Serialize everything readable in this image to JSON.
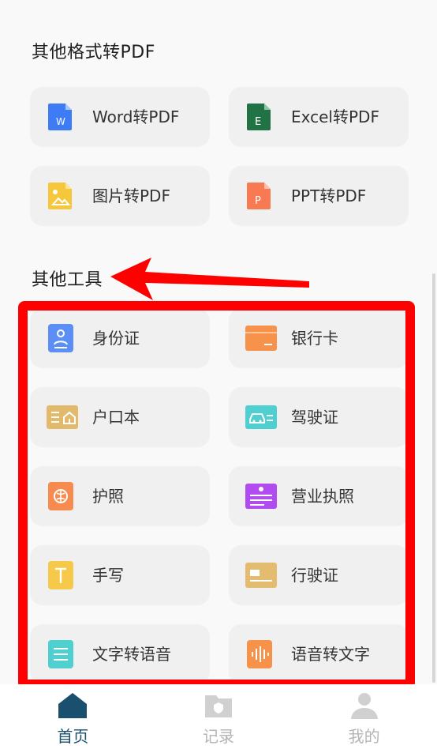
{
  "sections": {
    "convert_title": "其他格式转PDF",
    "tools_title": "其他工具"
  },
  "convert_cards": [
    {
      "label": "Word转PDF",
      "icon": "word-doc-icon",
      "color": "#3d7cf4"
    },
    {
      "label": "Excel转PDF",
      "icon": "excel-doc-icon",
      "color": "#217346"
    },
    {
      "label": "图片转PDF",
      "icon": "image-doc-icon",
      "color": "#f7c73b"
    },
    {
      "label": "PPT转PDF",
      "icon": "ppt-doc-icon",
      "color": "#f77a52"
    }
  ],
  "tool_cards": [
    {
      "label": "身份证",
      "icon": "id-card-icon",
      "color": "#5b8ff5"
    },
    {
      "label": "银行卡",
      "icon": "bank-card-icon",
      "color": "#f7924a"
    },
    {
      "label": "户口本",
      "icon": "household-register-icon",
      "color": "#e3b96b"
    },
    {
      "label": "驾驶证",
      "icon": "driver-license-icon",
      "color": "#4fcfd0"
    },
    {
      "label": "护照",
      "icon": "passport-icon",
      "color": "#f78a4e"
    },
    {
      "label": "营业执照",
      "icon": "business-license-icon",
      "color": "#b14cf0"
    },
    {
      "label": "手写",
      "icon": "handwriting-icon",
      "color": "#f7c94b"
    },
    {
      "label": "行驶证",
      "icon": "vehicle-license-icon",
      "color": "#e3bc70"
    },
    {
      "label": "文字转语音",
      "icon": "text-to-speech-icon",
      "color": "#4fcfd0"
    },
    {
      "label": "语音转文字",
      "icon": "speech-to-text-icon",
      "color": "#f7924a"
    }
  ],
  "bottom_nav": [
    {
      "label": "首页",
      "icon": "home-icon",
      "active": true
    },
    {
      "label": "记录",
      "icon": "records-icon",
      "active": false
    },
    {
      "label": "我的",
      "icon": "profile-icon",
      "active": false
    }
  ],
  "colors": {
    "highlight": "#ff0000",
    "nav_active": "#1a4f6e",
    "nav_inactive": "#b4b4b4"
  }
}
